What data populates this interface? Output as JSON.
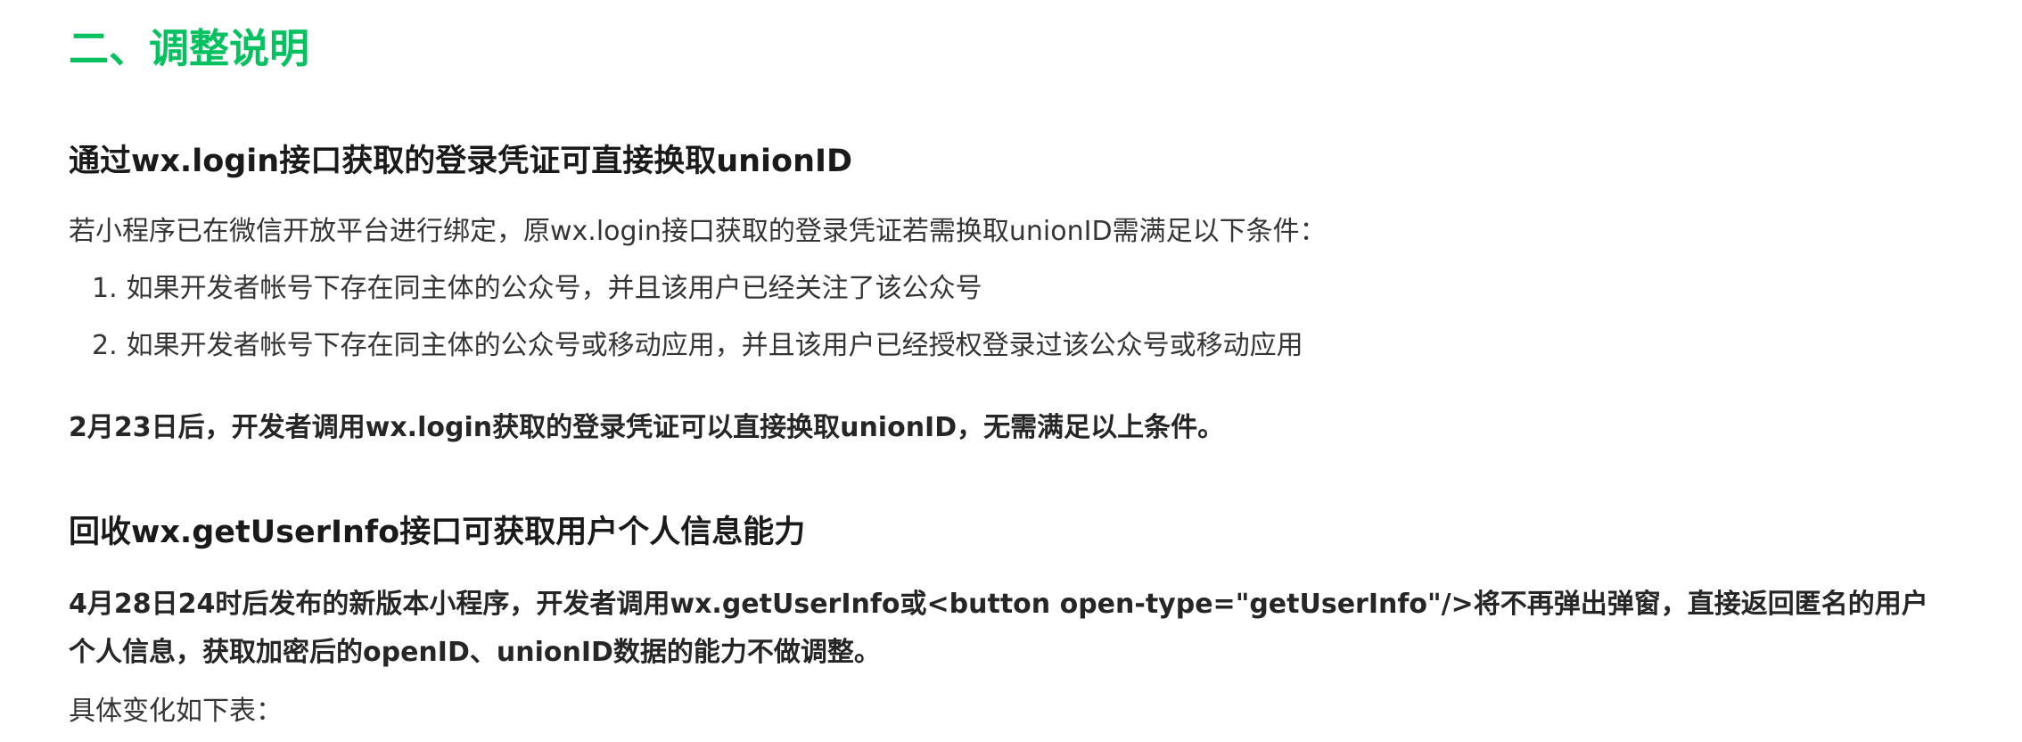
{
  "section": {
    "title": "二、调整说明"
  },
  "part1": {
    "title": "通过wx.login接口获取的登录凭证可直接换取unionID",
    "intro": "若小程序已在微信开放平台进行绑定，原wx.login接口获取的登录凭证若需换取unionID需满足以下条件：",
    "conditions": [
      {
        "num": "1.",
        "text": "如果开发者帐号下存在同主体的公众号，并且该用户已经关注了该公众号"
      },
      {
        "num": "2.",
        "text": "如果开发者帐号下存在同主体的公众号或移动应用，并且该用户已经授权登录过该公众号或移动应用"
      }
    ],
    "notice": "2月23日后，开发者调用wx.login获取的登录凭证可以直接换取unionID，无需满足以上条件。"
  },
  "part2": {
    "title": "回收wx.getUserInfo接口可获取用户个人信息能力",
    "notice_line1": "4月28日24时后发布的新版本小程序，开发者调用wx.getUserInfo或<button open-type=\"getUserInfo\"/>将不再弹出弹窗，直接返回匿名的用户",
    "notice_line2": "个人信息，获取加密后的openID、unionID数据的能力不做调整。",
    "table_intro": "具体变化如下表："
  },
  "colors": {
    "accent": "#07c160",
    "heading": "#1a1a1a",
    "body": "#353535"
  }
}
